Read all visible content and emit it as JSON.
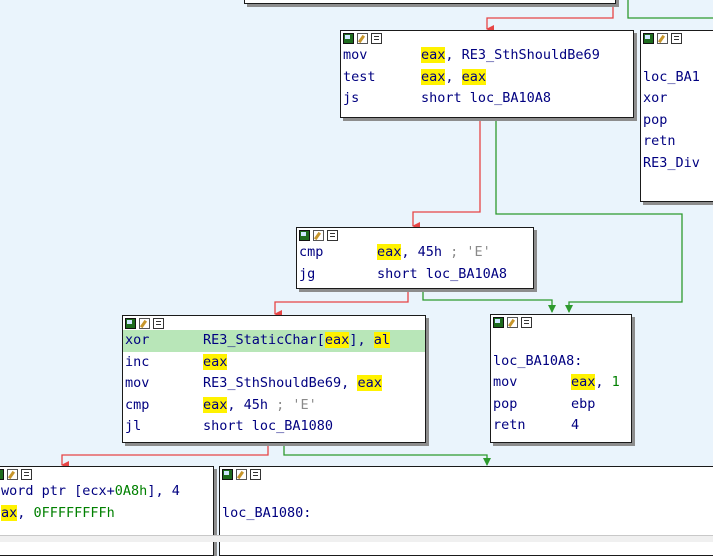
{
  "colors": {
    "background": "#eaf4fc",
    "edge_false": "#e64545",
    "edge_true": "#2e9a2e",
    "register_highlight": "#fff200",
    "selected_line": "#b8e6b8"
  },
  "header_icons": [
    "graph-color-icon",
    "edit-node-icon",
    "node-comment-icon"
  ],
  "blocks": [
    {
      "id": "b1",
      "lines": [
        {
          "mnemonic": "mov",
          "parts": [
            {
              "t": "eax",
              "hl": true
            },
            {
              "t": ", RE3_SthShouldBe69"
            }
          ]
        },
        {
          "mnemonic": "test",
          "parts": [
            {
              "t": "eax",
              "hl": true
            },
            {
              "t": ", "
            },
            {
              "t": "eax",
              "hl": true
            }
          ]
        },
        {
          "mnemonic": "js",
          "parts": [
            {
              "t": "short loc_BA10A8"
            }
          ]
        }
      ]
    },
    {
      "id": "b2",
      "lines": [
        {
          "mnemonic": "",
          "parts": []
        },
        {
          "mnemonic": "loc_BA1",
          "parts": []
        },
        {
          "mnemonic": "xor",
          "parts": []
        },
        {
          "mnemonic": "pop",
          "parts": []
        },
        {
          "mnemonic": "retn",
          "parts": []
        },
        {
          "mnemonic": "RE3_Div",
          "parts": []
        }
      ]
    },
    {
      "id": "b3",
      "lines": [
        {
          "mnemonic": "cmp",
          "parts": [
            {
              "t": "eax",
              "hl": true
            },
            {
              "t": ", 45h"
            },
            {
              "t": " ; 'E'",
              "cmt": true
            }
          ]
        },
        {
          "mnemonic": "jg",
          "parts": [
            {
              "t": "short loc_BA10A8"
            }
          ]
        }
      ]
    },
    {
      "id": "b4",
      "lines": [
        {
          "mnemonic": "xor",
          "sel": true,
          "parts": [
            {
              "t": "RE3_StaticChar["
            },
            {
              "t": "eax",
              "hl": true
            },
            {
              "t": "], "
            },
            {
              "t": "al",
              "hl": true
            }
          ]
        },
        {
          "mnemonic": "inc",
          "parts": [
            {
              "t": "eax",
              "hl": true
            }
          ]
        },
        {
          "mnemonic": "mov",
          "parts": [
            {
              "t": "RE3_SthShouldBe69, "
            },
            {
              "t": "eax",
              "hl": true
            }
          ]
        },
        {
          "mnemonic": "cmp",
          "parts": [
            {
              "t": "eax",
              "hl": true
            },
            {
              "t": ", 45h"
            },
            {
              "t": " ; 'E'",
              "cmt": true
            }
          ]
        },
        {
          "mnemonic": "jl",
          "parts": [
            {
              "t": "short loc_BA1080"
            }
          ]
        }
      ]
    },
    {
      "id": "b5",
      "lines": [
        {
          "mnemonic": "",
          "parts": []
        },
        {
          "mnemonic": "loc_BA10A8:",
          "parts": []
        },
        {
          "mnemonic": "mov",
          "parts": [
            {
              "t": "eax",
              "hl": true
            },
            {
              "t": ", "
            },
            {
              "t": "1",
              "num": true
            }
          ]
        },
        {
          "mnemonic": "pop",
          "parts": [
            {
              "t": "ebp"
            }
          ]
        },
        {
          "mnemonic": "retn",
          "parts": [
            {
              "t": "4"
            }
          ]
        }
      ]
    },
    {
      "id": "b6",
      "lines": [
        {
          "mnemonic": "",
          "parts": [
            {
              "t": "word ptr [ecx+"
            },
            {
              "t": "0A8h",
              "num": true
            },
            {
              "t": "], 4"
            }
          ]
        },
        {
          "mnemonic": "",
          "parts": [
            {
              "t": "ax",
              "hl": true
            },
            {
              "t": ", "
            },
            {
              "t": "0FFFFFFFFh",
              "num": true
            }
          ]
        }
      ]
    },
    {
      "id": "b7",
      "lines": [
        {
          "mnemonic": "",
          "parts": []
        },
        {
          "mnemonic": "loc_BA1080:",
          "parts": []
        }
      ]
    }
  ]
}
